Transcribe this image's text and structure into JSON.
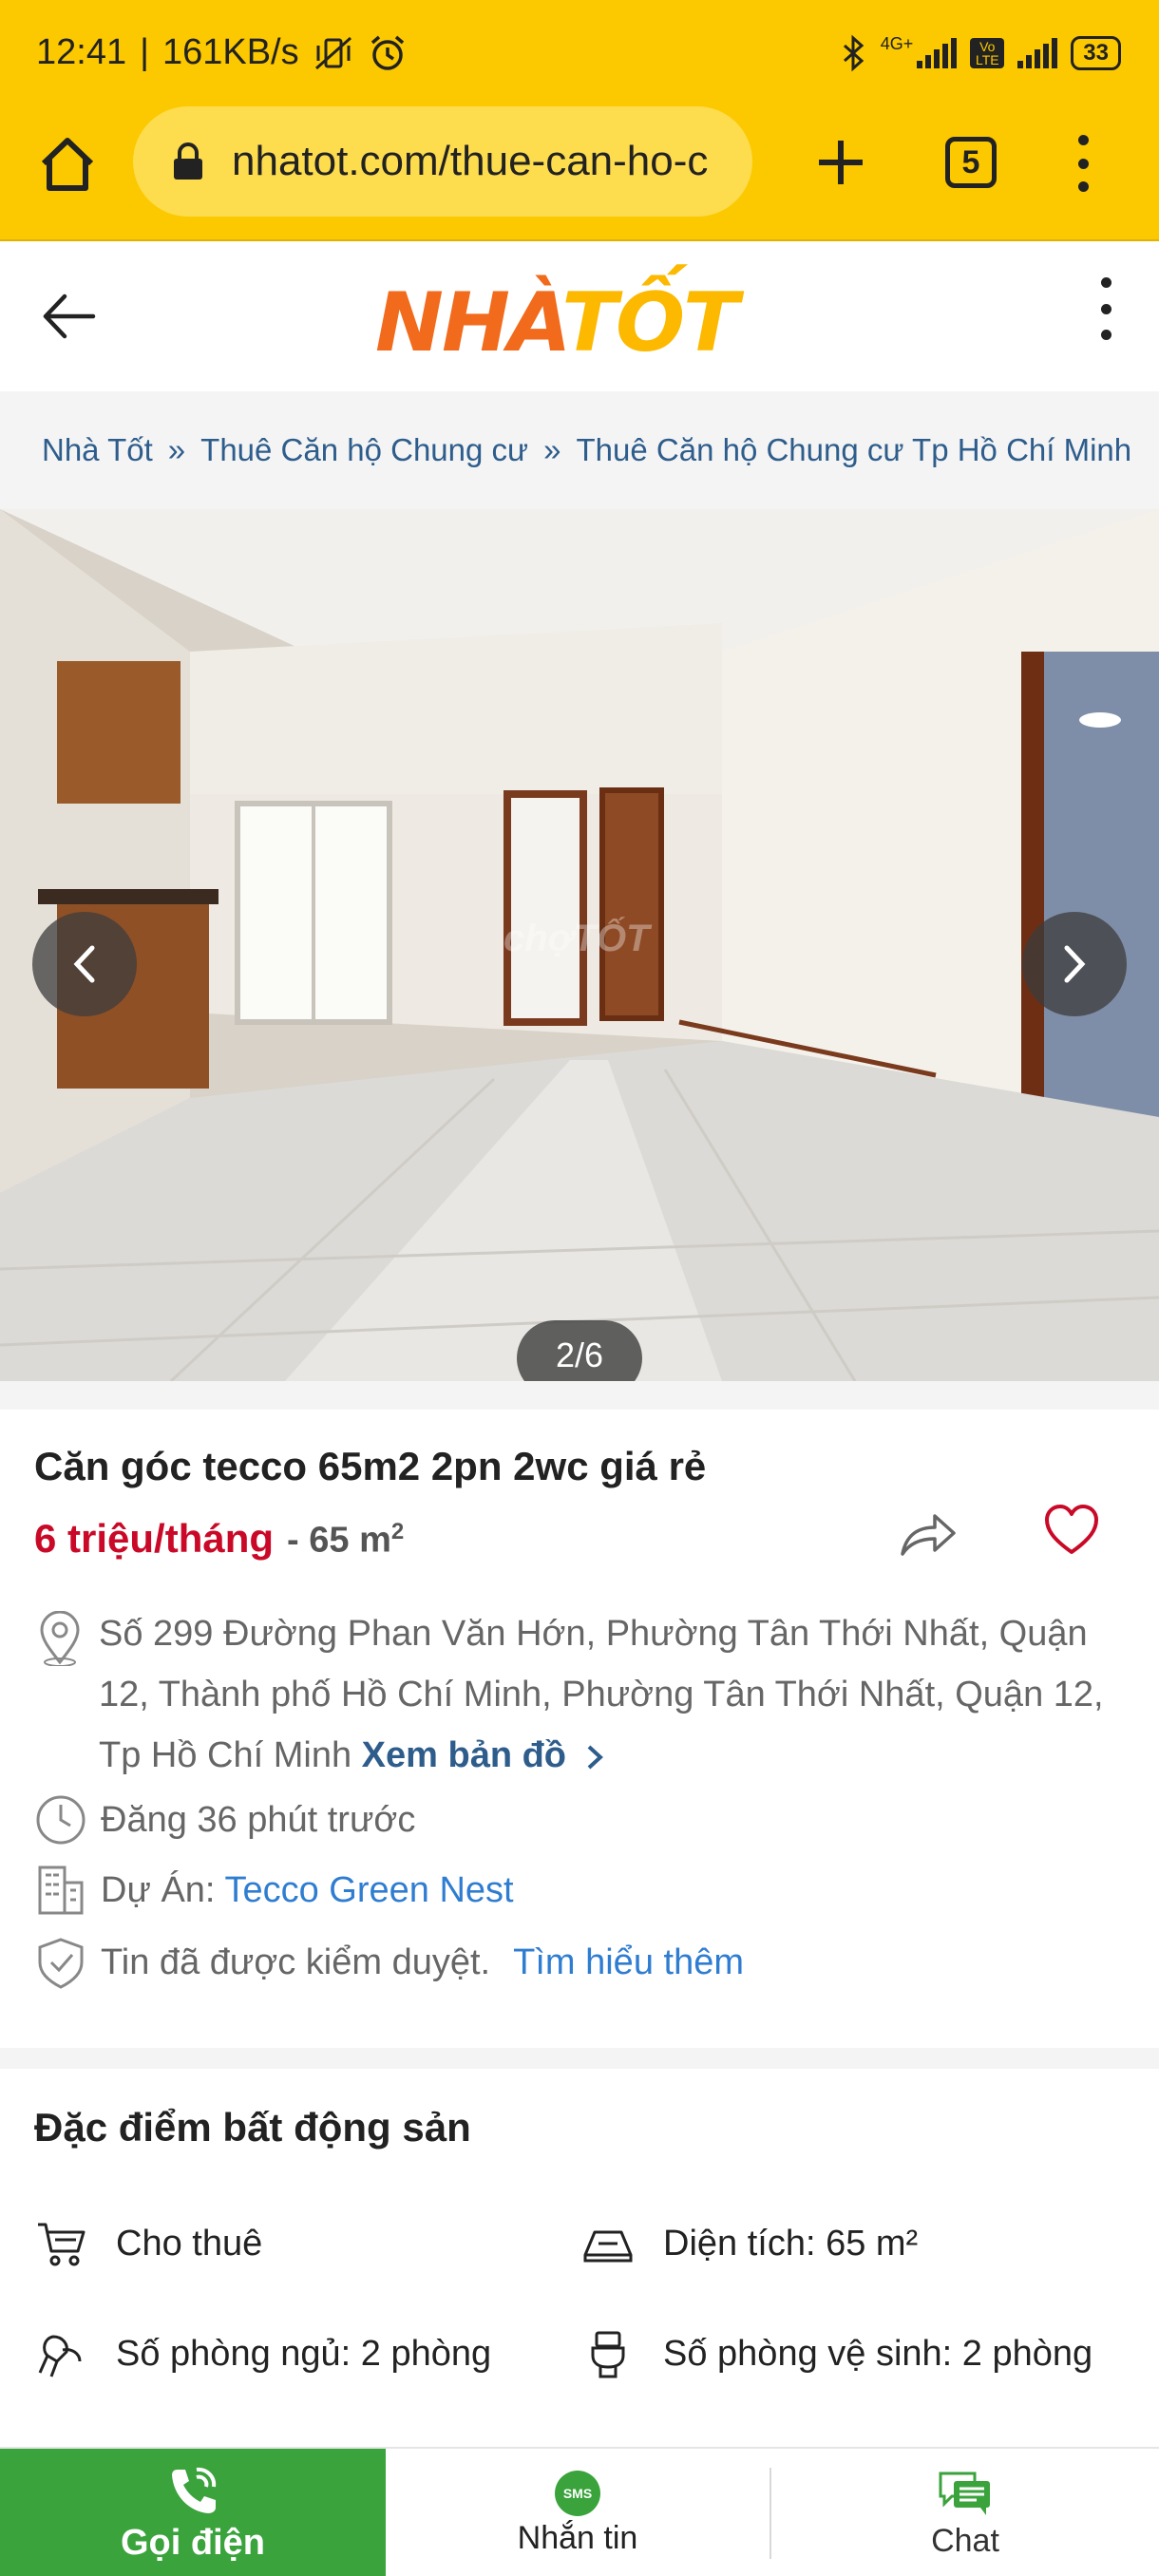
{
  "status_bar": {
    "time": "12:41",
    "speed": "161KB/s",
    "network": "4G+",
    "volte": "Vo LTE",
    "battery": "33"
  },
  "browser": {
    "url": "nhatot.com/thue-can-ho-c",
    "tab_count": "5"
  },
  "site": {
    "logo_main": "NHÀ",
    "logo_accent": "TỐT"
  },
  "breadcrumb": {
    "items": [
      "Nhà Tốt",
      "Thuê Căn hộ Chung cư",
      "Thuê Căn hộ Chung cư Tp Hồ Chí Minh"
    ],
    "separator": "»"
  },
  "gallery": {
    "counter": "2/6",
    "watermark": "chợTỐT"
  },
  "listing": {
    "title": "Căn góc tecco 65m2 2pn 2wc giá rẻ",
    "price": "6 triệu/tháng",
    "area_prefix": "- 65 m",
    "area_sup": "2",
    "address": "Số 299 Đường Phan Văn Hớn, Phường Tân Thới Nhất, Quận 12, Thành phố Hồ Chí Minh, Phường Tân Thới Nhất, Quận 12, Tp Hồ Chí Minh",
    "map_link": "Xem bản đồ",
    "posted": "Đăng 36 phút trước",
    "project_label": "Dự Án:",
    "project_name": "Tecco Green Nest",
    "verified_text": "Tin đã được kiểm duyệt.",
    "verified_link": "Tìm hiểu thêm"
  },
  "features": {
    "title": "Đặc điểm bất động sản",
    "items": [
      {
        "icon": "cart-icon",
        "text": "Cho thuê"
      },
      {
        "icon": "area-icon",
        "text": "Diện tích: 65 m²"
      },
      {
        "icon": "bed-icon",
        "text": "Số phòng ngủ: 2 phòng"
      },
      {
        "icon": "toilet-icon",
        "text": "Số phòng vệ sinh: 2 phòng"
      }
    ]
  },
  "actions": {
    "call": "Gọi điện",
    "sms": "Nhắn tin",
    "sms_badge": "SMS",
    "chat": "Chat"
  },
  "colors": {
    "browser_yellow": "#fcc800",
    "price_red": "#c90927",
    "call_green": "#3aa33c",
    "link_blue": "#2e5d8c",
    "logo_orange": "#f26a1b"
  }
}
